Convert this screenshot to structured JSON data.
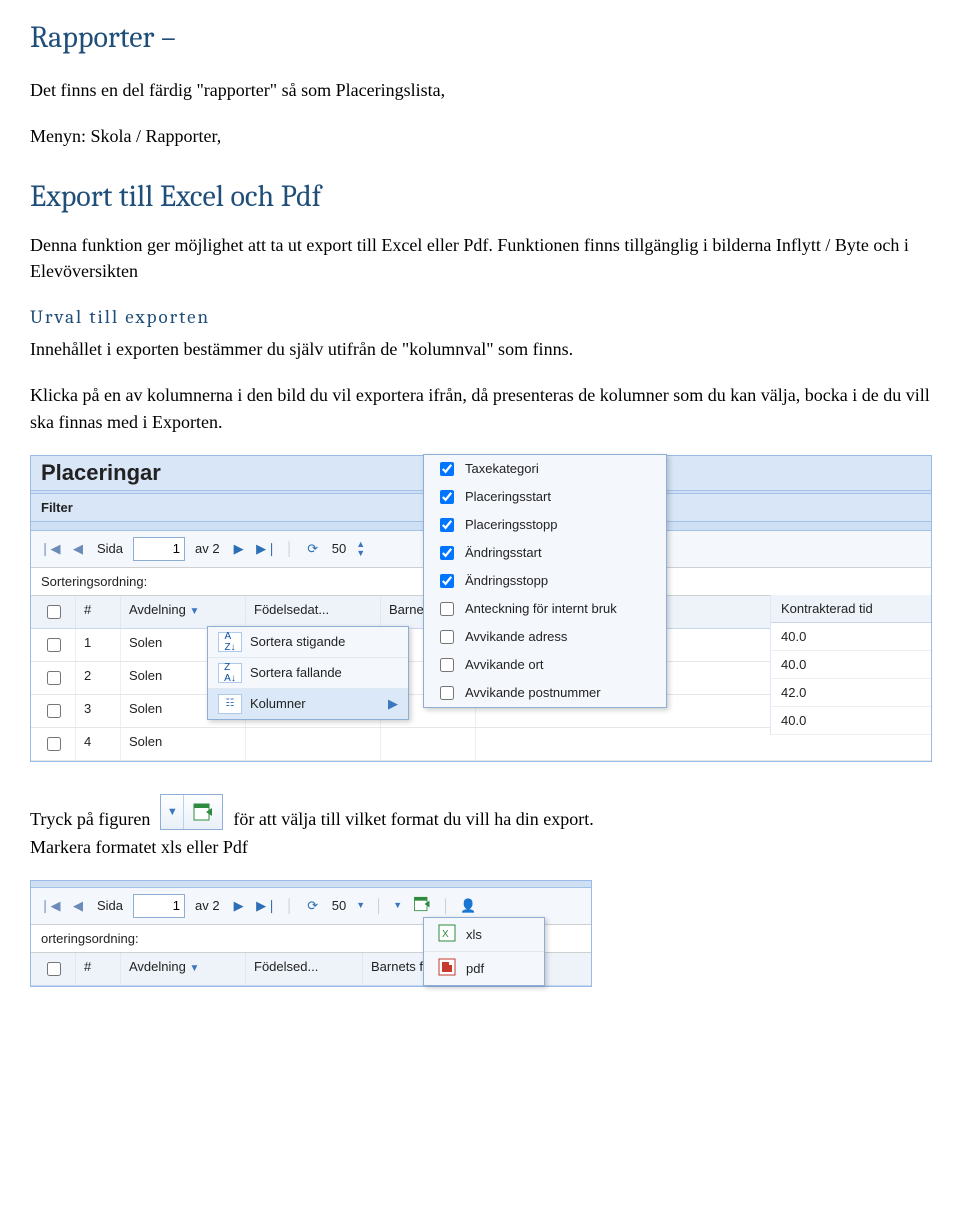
{
  "headings": {
    "rapporter": "Rapporter –",
    "export": "Export till Excel och Pdf",
    "urval": "Urval till exporten"
  },
  "paragraphs": {
    "p1a": "Det finns en del färdig \"rapporter\" så som Placeringslista,",
    "p1b": "Menyn: Skola / Rapporter,",
    "p2": "Denna funktion ger möjlighet att ta ut export till Excel eller Pdf. Funktionen finns tillgänglig i bilderna Inflytt / Byte och i Elevöversikten",
    "p3": "Innehållet i exporten bestämmer du själv utifrån de \"kolumnval\" som finns.",
    "p4": "Klicka på en av kolumnerna i den bild du vil exportera ifrån, då presenteras de kolumner som du kan välja, bocka i de du vill ska finnas med i Exporten.",
    "p5a": "Tryck på figuren",
    "p5b": "för att välja till vilket format du vill ha din export.",
    "p6": "Markera formatet xls eller Pdf"
  },
  "shot1": {
    "title": "Placeringar",
    "filter": "Filter",
    "pager": {
      "sida": "Sida",
      "page": "1",
      "av": "av 2",
      "count": "50"
    },
    "sortlabel": "Sorteringsordning:",
    "cols": {
      "hash": "#",
      "dept": "Avdelning",
      "dob": "Födelsedat...",
      "name": "Barnets"
    },
    "rows": [
      {
        "n": "1",
        "d": "Solen"
      },
      {
        "n": "2",
        "d": "Solen"
      },
      {
        "n": "3",
        "d": "Solen"
      },
      {
        "n": "4",
        "d": "Solen"
      }
    ],
    "sortmenu": {
      "asc": "Sortera stigande",
      "desc": "Sortera fallande",
      "cols": "Kolumner"
    },
    "checkmenu": [
      {
        "c": true,
        "l": "Taxekategori"
      },
      {
        "c": true,
        "l": "Placeringsstart"
      },
      {
        "c": true,
        "l": "Placeringsstopp"
      },
      {
        "c": true,
        "l": "Ändringsstart"
      },
      {
        "c": true,
        "l": "Ändringsstopp"
      },
      {
        "c": false,
        "l": "Anteckning för internt bruk"
      },
      {
        "c": false,
        "l": "Avvikande adress"
      },
      {
        "c": false,
        "l": "Avvikande ort"
      },
      {
        "c": false,
        "l": "Avvikande postnummer"
      }
    ],
    "rightcol": {
      "head": "Kontrakterad tid",
      "vals": [
        "40.0",
        "40.0",
        "42.0",
        "40.0"
      ]
    }
  },
  "shot2": {
    "pager": {
      "sida": "Sida",
      "page": "1",
      "av": "av 2",
      "count": "50"
    },
    "sort": "orteringsordning:",
    "cols": {
      "hash": "#",
      "dept": "Avdelning",
      "dob": "Födelsed...",
      "name": "Barnets f"
    },
    "formats": {
      "xls": "xls",
      "pdf": "pdf"
    }
  }
}
